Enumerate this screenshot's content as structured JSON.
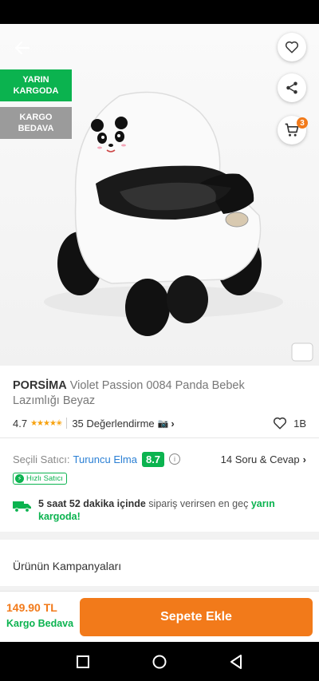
{
  "header": {
    "back_icon": "arrow-left-icon",
    "favorite_icon": "heart-icon",
    "share_icon": "share-icon",
    "cart_icon": "cart-icon",
    "cart_count": "3"
  },
  "badges": {
    "tomorrow_cargo": "YARIN KARGODA",
    "free_cargo": "KARGO BEDAVA"
  },
  "product": {
    "brand": "PORSİMA",
    "name": "Violet Passion 0084 Panda Bebek Lazımlığı Beyaz",
    "rating": "4.7",
    "stars_value": 4.7,
    "reviews": "35 Değerlendirme",
    "likes": "1B"
  },
  "seller": {
    "label": "Seçili Satıcı:",
    "name": "Turuncu Elma",
    "score": "8.7",
    "qa": "14 Soru & Cevap",
    "fast_label": "Hızlı Satıcı"
  },
  "delivery": {
    "time_bold": "5 saat 52 dakika içinde",
    "middle": " sipariş verirsen en geç ",
    "when": "yarın kargoda!"
  },
  "campaigns": {
    "title": "Ürünün Kampanyaları"
  },
  "bottom": {
    "price": "149.90 TL",
    "cargo": "Kargo Bedava",
    "add_to_cart": "Sepete Ekle"
  },
  "colors": {
    "accent_orange": "#f27a1a",
    "green": "#0bb34f",
    "seller_blue": "#2a7fd4"
  }
}
